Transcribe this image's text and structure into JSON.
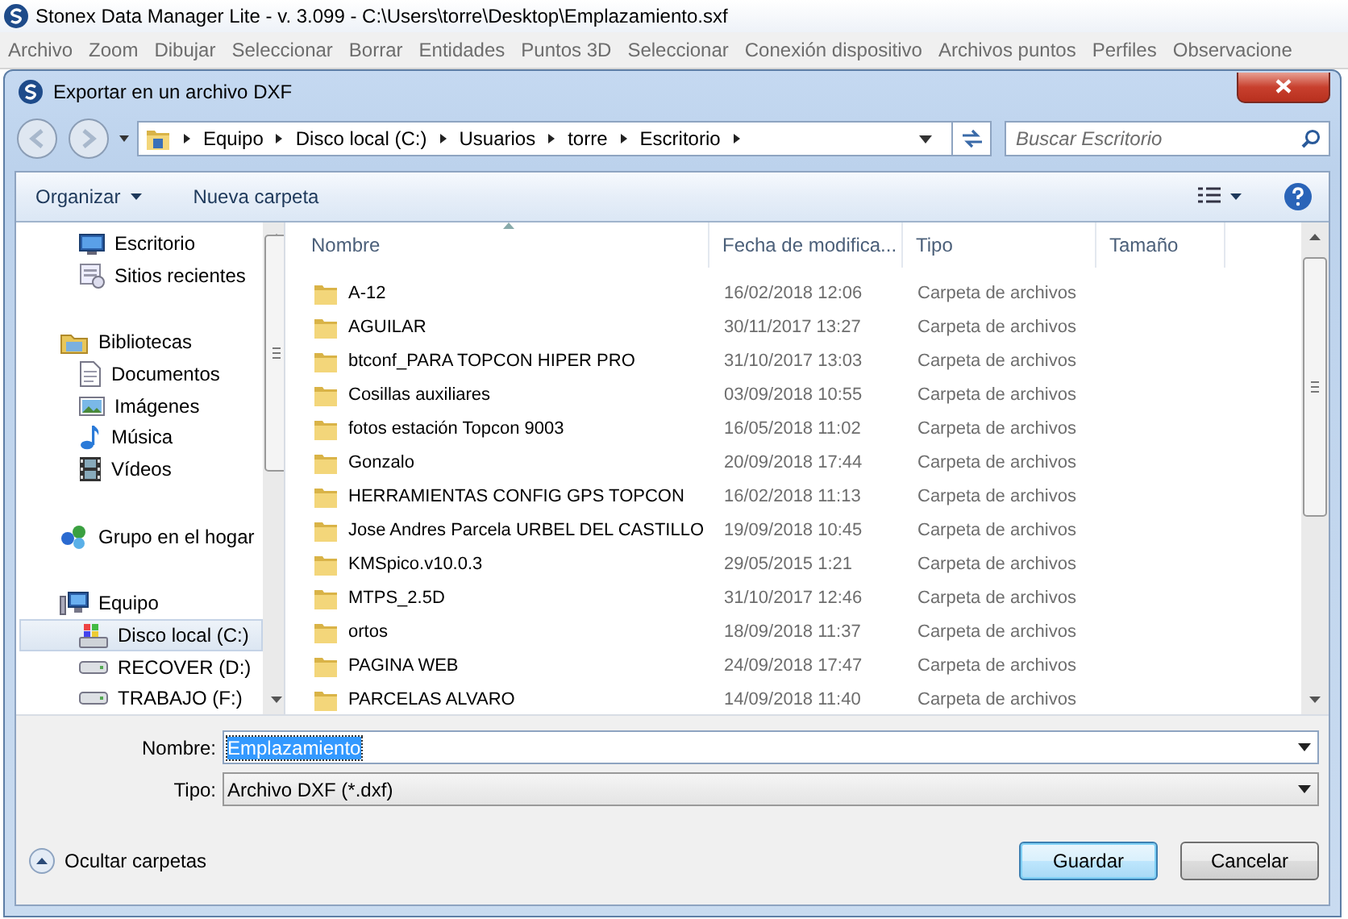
{
  "app": {
    "title": "Stonex Data Manager Lite - v. 3.099 - C:\\Users\\torre\\Desktop\\Emplazamiento.sxf",
    "menu": [
      "Archivo",
      "Zoom",
      "Dibujar",
      "Seleccionar",
      "Borrar",
      "Entidades",
      "Puntos 3D",
      "Seleccionar",
      "Conexión dispositivo",
      "Archivos puntos",
      "Perfiles",
      "Observacione"
    ]
  },
  "dialog": {
    "title": "Exportar en un archivo DXF",
    "breadcrumb": [
      "Equipo",
      "Disco local (C:)",
      "Usuarios",
      "torre",
      "Escritorio"
    ],
    "search": {
      "placeholder": "Buscar Escritorio"
    },
    "toolbar": [
      {
        "label": "Organizar",
        "kind": "menu"
      },
      {
        "label": "Nueva carpeta",
        "kind": "button"
      }
    ],
    "nav": [
      {
        "children": [
          {
            "label": "Escritorio",
            "kind": "desktop",
            "selected": false
          },
          {
            "label": "Sitios recientes",
            "kind": "recent",
            "selected": false
          }
        ]
      },
      {
        "label": "Bibliotecas",
        "kind": "library",
        "selected": false,
        "children": [
          {
            "label": "Documentos",
            "kind": "document",
            "selected": false
          },
          {
            "label": "Imágenes",
            "kind": "pictures",
            "selected": false
          },
          {
            "label": "Música",
            "kind": "music",
            "selected": false
          },
          {
            "label": "Vídeos",
            "kind": "videos",
            "selected": false
          }
        ]
      },
      {
        "label": "Grupo en el hogar",
        "kind": "homegroup",
        "selected": false
      },
      {
        "label": "Equipo",
        "kind": "computer",
        "selected": false,
        "children": [
          {
            "label": "Disco local (C:)",
            "kind": "system-drive",
            "selected": true
          },
          {
            "label": "RECOVER (D:)",
            "kind": "drive",
            "selected": false
          },
          {
            "label": "TRABAJO (F:)",
            "kind": "drive",
            "selected": false
          }
        ]
      }
    ],
    "table": {
      "columns": [
        {
          "label": "Nombre",
          "sorted": true
        },
        {
          "label": "Fecha de modifica...",
          "sorted": false
        },
        {
          "label": "Tipo",
          "sorted": false
        },
        {
          "label": "Tamaño",
          "sorted": false
        }
      ],
      "rows": [
        {
          "name": "A-12",
          "date": "16/02/2018 12:06",
          "type": "Carpeta de archivos",
          "selected": false
        },
        {
          "name": "AGUILAR",
          "date": "30/11/2017 13:27",
          "type": "Carpeta de archivos",
          "selected": false
        },
        {
          "name": "btconf_PARA TOPCON HIPER PRO",
          "date": "31/10/2017 13:03",
          "type": "Carpeta de archivos",
          "selected": false
        },
        {
          "name": "Cosillas auxiliares",
          "date": "03/09/2018 10:55",
          "type": "Carpeta de archivos",
          "selected": false
        },
        {
          "name": "fotos estación Topcon 9003",
          "date": "16/05/2018 11:02",
          "type": "Carpeta de archivos",
          "selected": false
        },
        {
          "name": "Gonzalo",
          "date": "20/09/2018 17:44",
          "type": "Carpeta de archivos",
          "selected": false
        },
        {
          "name": "HERRAMIENTAS CONFIG GPS TOPCON",
          "date": "16/02/2018 11:13",
          "type": "Carpeta de archivos",
          "selected": false
        },
        {
          "name": "Jose Andres Parcela URBEL DEL CASTILLO",
          "date": "19/09/2018 10:45",
          "type": "Carpeta de archivos",
          "selected": false
        },
        {
          "name": "KMSpico.v10.0.3",
          "date": "29/05/2015 1:21",
          "type": "Carpeta de archivos",
          "selected": false
        },
        {
          "name": "MTPS_2.5D",
          "date": "31/10/2017 12:46",
          "type": "Carpeta de archivos",
          "selected": false
        },
        {
          "name": "ortos",
          "date": "18/09/2018 11:37",
          "type": "Carpeta de archivos",
          "selected": false
        },
        {
          "name": "PAGINA WEB",
          "date": "24/09/2018 17:47",
          "type": "Carpeta de archivos",
          "selected": false
        },
        {
          "name": "PARCELAS ALVARO",
          "date": "14/09/2018 11:40",
          "type": "Carpeta de archivos",
          "selected": false
        }
      ]
    },
    "fields": [
      {
        "label": "Nombre:",
        "value": "Emplazamiento",
        "highlighted": true,
        "kind": "combo"
      },
      {
        "label": "Tipo:",
        "value": "Archivo DXF (*.dxf)",
        "highlighted": false,
        "kind": "select"
      }
    ],
    "hide_folders": "Ocultar carpetas",
    "buttons": [
      {
        "label": "Guardar",
        "default": true
      },
      {
        "label": "Cancelar",
        "default": false
      }
    ]
  }
}
